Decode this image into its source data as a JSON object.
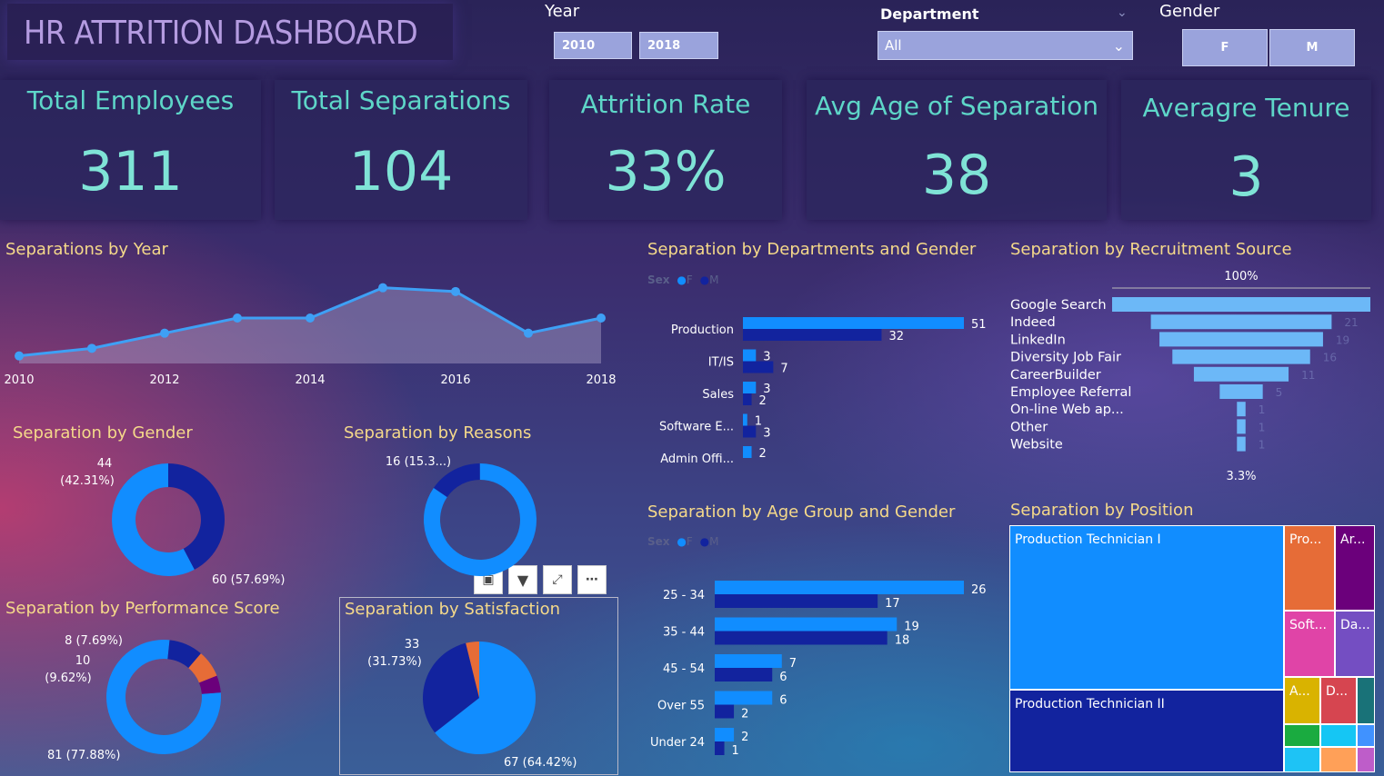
{
  "header": {
    "title": "HR ATTRITION DASHBOARD"
  },
  "filters": {
    "year_label": "Year",
    "year_from": "2010",
    "year_to": "2018",
    "department_label": "Department",
    "department_value": "All",
    "gender_label": "Gender",
    "gender_options": [
      "F",
      "M"
    ]
  },
  "kpis": [
    {
      "title": "Total Employees",
      "value": "311"
    },
    {
      "title": "Total Separations",
      "value": "104"
    },
    {
      "title": "Attrition Rate",
      "value": "33%"
    },
    {
      "title": "Avg Age of Separation",
      "value": "38"
    },
    {
      "title": "Averagre Tenure",
      "value": "3"
    }
  ],
  "sections": {
    "by_year": "Separations by Year",
    "by_gender": "Separation by Gender",
    "by_reasons": "Separation by Reasons",
    "by_performance": "Separation by Performance Score",
    "by_satisfaction": "Separation by Satisfaction",
    "by_dept_gender": "Separation by Departments and Gender",
    "by_age_gender": "Separation by Age Group and Gender",
    "by_recruitment": "Separation by Recruitment Source",
    "by_position": "Separation by Position"
  },
  "legend": {
    "title": "Sex",
    "f": "F",
    "m": "M"
  },
  "colors": {
    "light": "#118DFF",
    "dark": "#12239E",
    "orange": "#E66C37",
    "purple": "#6B007B",
    "teal": "#5ed6c8",
    "funnel": "#6cb8f7",
    "yellow_title": "#f5d98a"
  },
  "chart_data": [
    {
      "id": "year",
      "type": "area",
      "x": [
        2010,
        2011,
        2012,
        2013,
        2014,
        2015,
        2016,
        2017,
        2018
      ],
      "y": [
        1,
        2,
        4,
        6,
        6,
        10,
        9.5,
        4,
        6
      ],
      "x_tick_labels": [
        "2010",
        "2012",
        "2014",
        "2016",
        "2018"
      ],
      "ylim": [
        0,
        12
      ]
    },
    {
      "id": "gender",
      "type": "pie",
      "labels": [
        "M",
        "F"
      ],
      "values": [
        44,
        60
      ],
      "data_labels": [
        "44\n(42.31%)",
        "60 (57.69%)"
      ]
    },
    {
      "id": "reasons",
      "type": "pie",
      "values": [
        16,
        88
      ],
      "data_labels": [
        "16 (15.3...)"
      ]
    },
    {
      "id": "performance",
      "type": "pie",
      "values": [
        81,
        10,
        8,
        5
      ],
      "data_labels": [
        "81 (77.88%)",
        "10\n(9.62%)",
        "8 (7.69%)"
      ]
    },
    {
      "id": "satisfaction",
      "type": "pie",
      "values": [
        67,
        33,
        4
      ],
      "data_labels": [
        "67 (64.42%)",
        "33\n(31.73%)"
      ]
    },
    {
      "id": "dept_gender",
      "type": "bar",
      "categories": [
        "Production",
        "IT/IS",
        "Sales",
        "Software E...",
        "Admin Offi..."
      ],
      "series": [
        {
          "name": "F",
          "values": [
            51,
            3,
            3,
            1,
            2
          ]
        },
        {
          "name": "M",
          "values": [
            32,
            7,
            2,
            3,
            null
          ]
        }
      ]
    },
    {
      "id": "age_gender",
      "type": "bar",
      "categories": [
        "25 - 34",
        "35 - 44",
        "45 - 54",
        "Over 55",
        "Under 24"
      ],
      "series": [
        {
          "name": "F",
          "values": [
            26,
            19,
            7,
            6,
            2
          ]
        },
        {
          "name": "M",
          "values": [
            17,
            18,
            6,
            2,
            1
          ]
        }
      ]
    },
    {
      "id": "recruitment",
      "type": "funnel",
      "categories": [
        "Google Search",
        "Indeed",
        "LinkedIn",
        "Diversity Job Fair",
        "CareerBuilder",
        "Employee Referral",
        "On-line Web ap...",
        "Other",
        "Website"
      ],
      "values": [
        30,
        21,
        19,
        16,
        11,
        5,
        1,
        1,
        1
      ],
      "top_label": "100%",
      "bottom_label": "3.3%"
    },
    {
      "id": "position",
      "type": "treemap",
      "labels": [
        "Production Technician I",
        "Production Technician II",
        "Pro...",
        "Ar...",
        "Soft...",
        "Da...",
        "A...",
        "D..."
      ]
    }
  ]
}
